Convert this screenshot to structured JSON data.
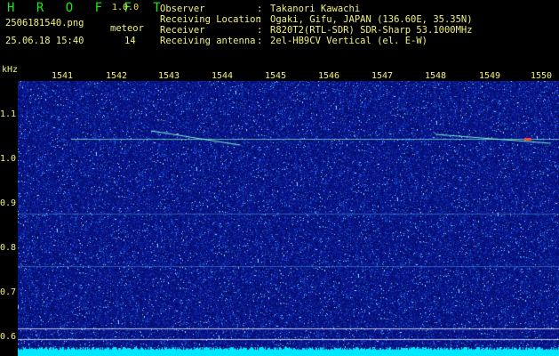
{
  "app": {
    "title": "H R O F F T",
    "version": "1.0.0"
  },
  "file": {
    "name": "2506181540.png",
    "timestamp": "25.06.18 15:40"
  },
  "meteor": {
    "label": "meteor",
    "count": "14"
  },
  "info": [
    {
      "key": "Observer",
      "value": "Takanori Kawachi"
    },
    {
      "key": "Receiving Location",
      "value": "Ogaki, Gifu, JAPAN (136.60E, 35.35N)"
    },
    {
      "key": "Receiver",
      "value": "R820T2(RTL-SDR) SDR-Sharp 53.1000MHz"
    },
    {
      "key": "Receiving antenna",
      "value": "2el-HB9CV Vertical (el. E-W)"
    }
  ],
  "axis": {
    "y_unit": "kHz",
    "x_ticks": [
      "1541",
      "1542",
      "1543",
      "1544",
      "1545",
      "1546",
      "1547",
      "1548",
      "1549",
      "1550"
    ],
    "y_ticks": [
      "1.1",
      "1.0",
      "0.9",
      "0.8",
      "0.7",
      "0.6"
    ]
  },
  "colors": {
    "background": "#000000",
    "text": "#f2f27a",
    "title": "#14e81a",
    "spectrum_base": "#0a1a8c",
    "baseline": "#00e8ff"
  }
}
